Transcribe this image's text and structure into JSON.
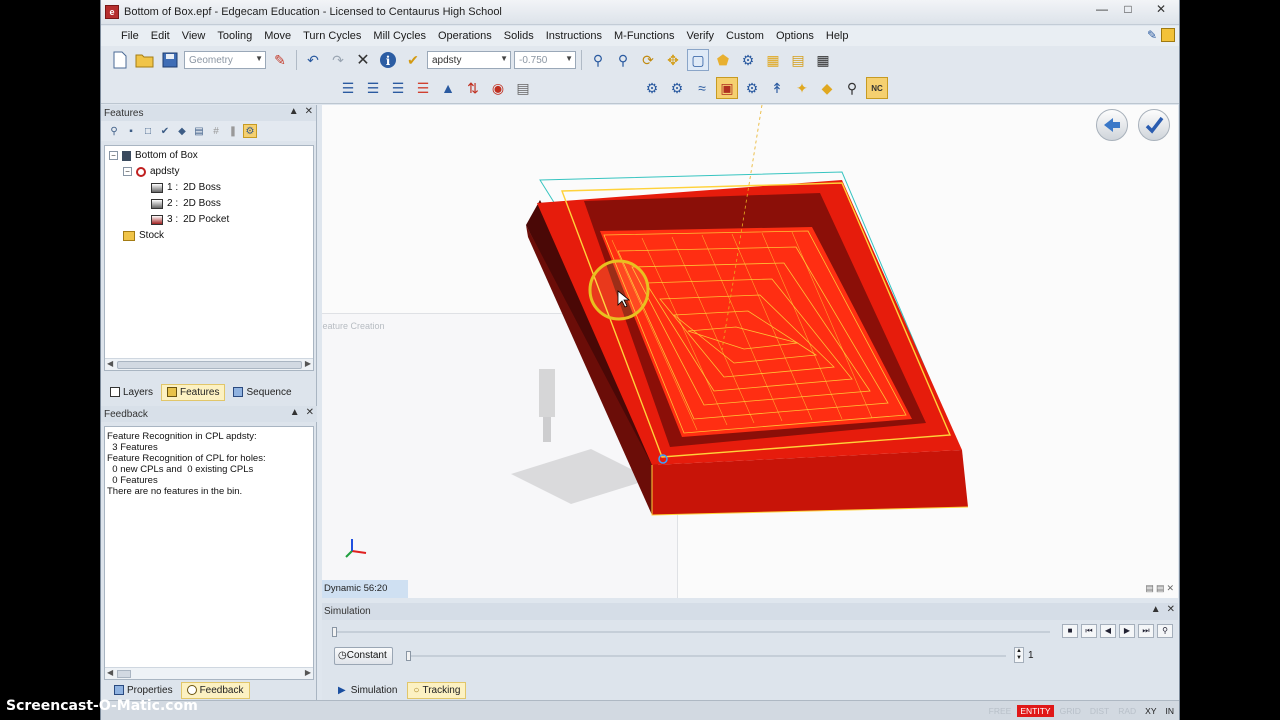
{
  "window": {
    "title": "Bottom of Box.epf - Edgecam Education - Licensed to Centaurus High School",
    "controls": [
      "minimize",
      "maximize",
      "close"
    ]
  },
  "menu": [
    "File",
    "Edit",
    "View",
    "Tooling",
    "Move",
    "Turn Cycles",
    "Mill Cycles",
    "Operations",
    "Solids",
    "Instructions",
    "M-Functions",
    "Verify",
    "Custom",
    "Options",
    "Help"
  ],
  "toolbar": {
    "geometry_combo": "Geometry",
    "cpl_combo": "apdsty",
    "depth_combo": "-0.750"
  },
  "features_panel": {
    "title": "Features",
    "tree": {
      "root": "Bottom of Box",
      "cpl": "apdsty",
      "features": [
        {
          "num": "1 :",
          "name": "2D Boss"
        },
        {
          "num": "2 :",
          "name": "2D Boss"
        },
        {
          "num": "3 :",
          "name": "2D Pocket"
        }
      ],
      "stock": "Stock"
    },
    "tabs": [
      "Layers",
      "Features",
      "Sequence"
    ],
    "active_tab": "Features"
  },
  "feedback_panel": {
    "title": "Feedback",
    "lines": [
      "Feature Recognition in CPL apdsty:",
      "  3 Features",
      "",
      "Feature Recognition of CPL for holes:",
      "  0 new CPLs and  0 existing CPLs",
      "  0 Features",
      "",
      "There are no features in the bin."
    ],
    "tabs": [
      "Properties",
      "Feedback"
    ],
    "active_tab": "Feedback"
  },
  "viewport": {
    "status_label": "Dynamic 56:20",
    "ghost_dialog_title": "Feature Creation"
  },
  "simulation": {
    "title": "Simulation",
    "speed_button": "Constant",
    "speed_value": "1",
    "progress": 0.0,
    "tabs": [
      "Simulation",
      "Tracking"
    ]
  },
  "statusbar": {
    "items": [
      {
        "text": "FREE",
        "state": "off"
      },
      {
        "text": "ENTITY",
        "state": "red"
      },
      {
        "text": "GRID",
        "state": "off"
      },
      {
        "text": "DIST",
        "state": "off"
      },
      {
        "text": "RAD",
        "state": "off"
      },
      {
        "text": "XY",
        "state": "on"
      },
      {
        "text": "IN",
        "state": "on"
      }
    ]
  },
  "watermark": "Screencast-O-Matic.com",
  "colors": {
    "accent_red": "#e01818",
    "part_red": "#e61c0c",
    "part_dark": "#6b0d08",
    "toolpath_yellow": "#ffd23a",
    "tab_active": "#fcf1c2"
  }
}
